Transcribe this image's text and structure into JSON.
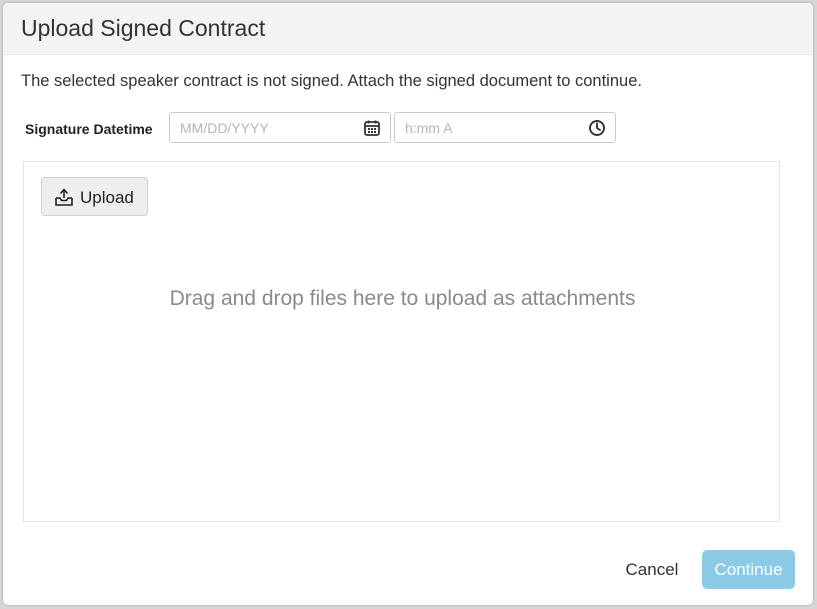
{
  "dialog": {
    "title": "Upload Signed Contract",
    "message": "The selected speaker contract is not signed. Attach the signed document to continue."
  },
  "signature": {
    "label": "Signature Datetime",
    "date_placeholder": "MM/DD/YYYY",
    "date_value": "",
    "date_icon": "calendar-icon",
    "time_placeholder": "h:mm A",
    "time_value": "",
    "time_icon": "clock-icon"
  },
  "dropzone": {
    "upload_label": "Upload",
    "upload_icon": "upload-tray-icon",
    "hint": "Drag and drop files here to upload as attachments"
  },
  "footer": {
    "cancel_label": "Cancel",
    "continue_label": "Continue",
    "continue_color": "#8ccbe8"
  }
}
